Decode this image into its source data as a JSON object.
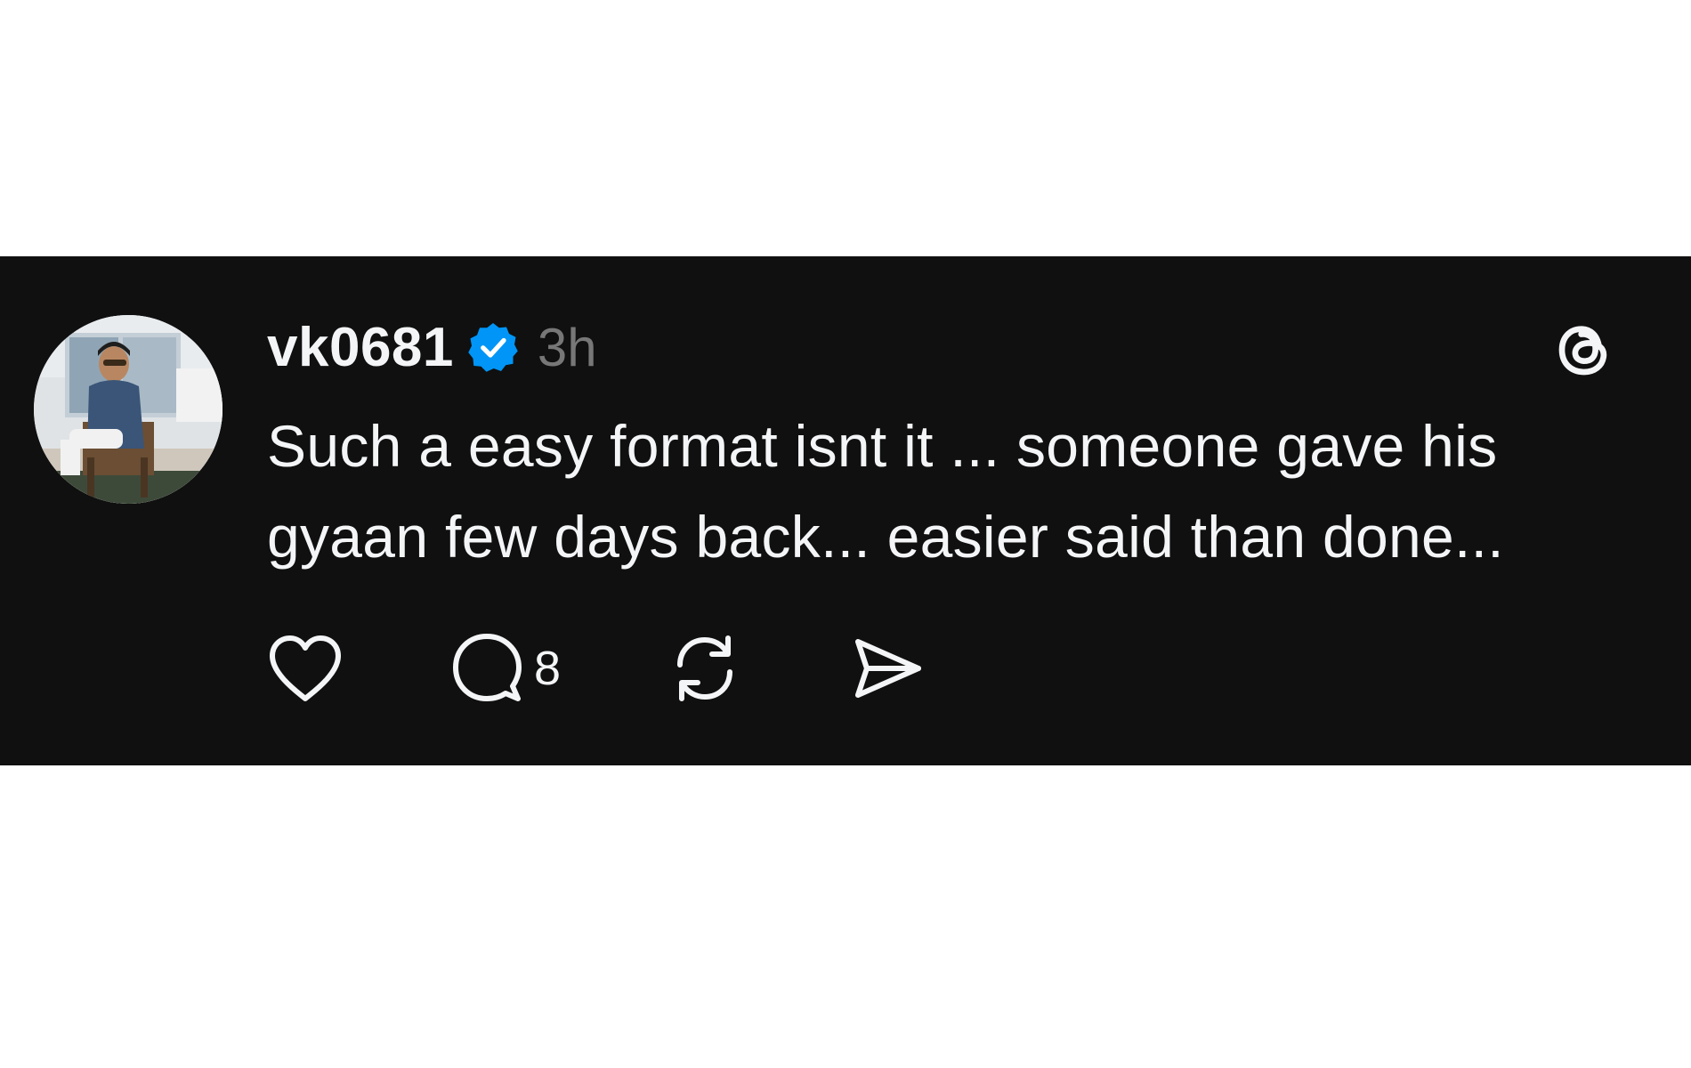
{
  "post": {
    "username": "vk0681",
    "verified": true,
    "time": "3h",
    "text": "Such a easy format isnt it ... someone gave his gyaan few days back... easier said than done...",
    "actions": {
      "like_icon": "heart-icon",
      "reply_icon": "comment-bubble-icon",
      "reply_count": "8",
      "repost_icon": "repost-icon",
      "share_icon": "send-icon"
    }
  },
  "colors": {
    "card_background": "#101010",
    "page_background": "#ffffff",
    "primary_text": "#f3f5f7",
    "secondary_text": "#777777",
    "verified_badge": "#0095f6"
  }
}
